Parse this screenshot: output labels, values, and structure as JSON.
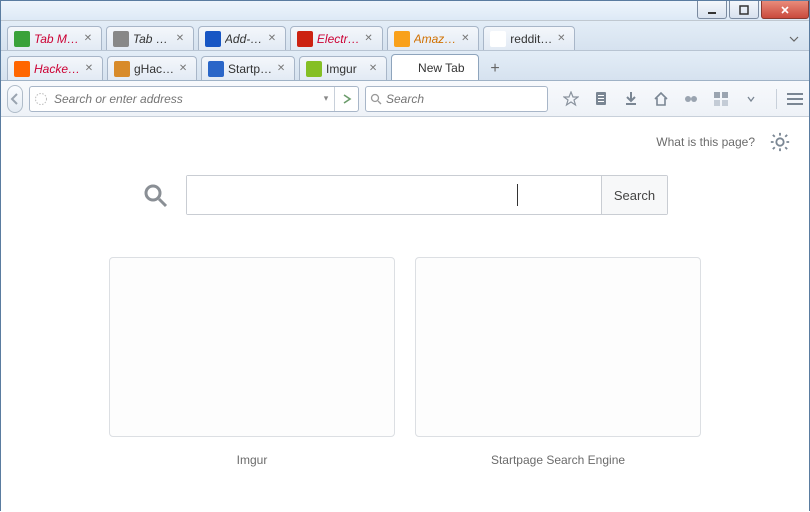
{
  "window": {
    "min_label": "minimize",
    "max_label": "maximize",
    "close_label": "close"
  },
  "tabs_row1": [
    {
      "label": "Tab M…",
      "color": "#3aa23a",
      "italic": true,
      "label_color": "#c03"
    },
    {
      "label": "Tab …",
      "color": "#888",
      "italic": true
    },
    {
      "label": "Add-…",
      "color": "#1756c4",
      "italic": true
    },
    {
      "label": "Electr…",
      "color": "#c21",
      "italic": true,
      "label_color": "#c03"
    },
    {
      "label": "Amaz…",
      "color": "#f9a11b",
      "italic": true,
      "label_color": "#d07000"
    },
    {
      "label": "reddit…",
      "color": "#fff",
      "italic": false
    }
  ],
  "tabs_row2": [
    {
      "label": "Hacke…",
      "color": "#ff6600",
      "italic": true,
      "label_color": "#c03"
    },
    {
      "label": "gHac…",
      "color": "#d88b2a",
      "italic": false
    },
    {
      "label": "Startp…",
      "color": "#2a66c8",
      "italic": false
    },
    {
      "label": "Imgur",
      "color": "#85bf25",
      "italic": false
    },
    {
      "label": "New Tab",
      "color": "",
      "italic": false,
      "active": true
    }
  ],
  "navbar": {
    "url_placeholder": "Search or enter address",
    "search_placeholder": "Search"
  },
  "newtab": {
    "what_is": "What is this page?",
    "search_button": "Search",
    "tiles": [
      {
        "label": "Imgur"
      },
      {
        "label": "Startpage Search Engine"
      }
    ]
  }
}
